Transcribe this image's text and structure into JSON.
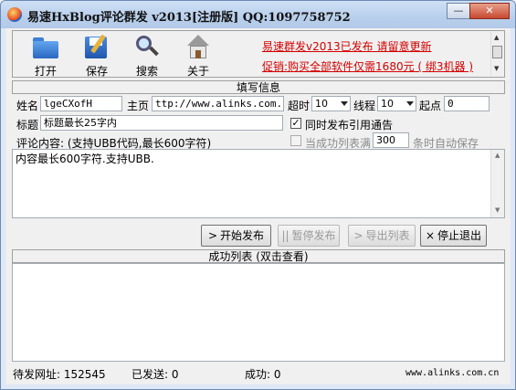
{
  "window": {
    "title": "易速HxBlog评论群发  v2013[注册版]  QQ:1097758752"
  },
  "toolbar": {
    "open_label": "打开",
    "save_label": "保存",
    "search_label": "搜索",
    "about_label": "关于"
  },
  "ads": {
    "line1": "易速群发v2013已发布 请留意更新",
    "line2": "促销:购买全部软件仅需1680元 ( 绑3机器 )"
  },
  "form": {
    "section_title": "填写信息",
    "name_label": "姓名",
    "name_value": "lgeCXofH",
    "homepage_label": "主页",
    "homepage_value": "ttp://www.alinks.com.cn",
    "timeout_label": "超时",
    "timeout_value": "10",
    "threads_label": "线程",
    "threads_value": "10",
    "start_label": "起点",
    "start_value": "0",
    "subject_label": "标题",
    "subject_value": "标题最长25字内",
    "trackback_label": "同时发布引用通告",
    "trackback_checked": "✓",
    "content_label": "评论内容: (支持UBB代码,最长600字符)",
    "autosave_pre": "当成功列表满",
    "autosave_value": "300",
    "autosave_post": "条时自动保存",
    "content_value": "内容最长600字符.支持UBB."
  },
  "actions": {
    "start_label": "开始发布",
    "start_glyph": ">",
    "pause_label": "暂停发布",
    "pause_glyph": "||",
    "export_label": "导出列表",
    "export_glyph": ">",
    "stop_label": "停止退出",
    "stop_glyph": "×"
  },
  "success_list": {
    "title": "成功列表 (双击查看)"
  },
  "status": {
    "pending_label": "待发网址:",
    "pending_value": "152545",
    "sent_label": "已发送:",
    "sent_value": "0",
    "success_label": "成功:",
    "success_value": "0",
    "site": "www.alinks.com.cn"
  },
  "colors": {
    "ad_text": "#d40000",
    "title_bg": "#b8cfec"
  }
}
